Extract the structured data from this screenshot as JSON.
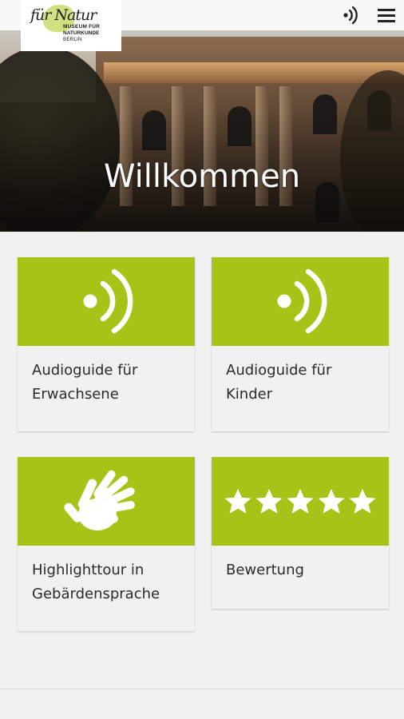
{
  "header": {
    "logo": {
      "script_text": "für Natur",
      "line1": "MUSEUM FÜR",
      "line2": "NATURKUNDE",
      "line3": "BERLIN"
    },
    "audio_icon": "audio-waves-icon",
    "menu_icon": "hamburger-menu-icon"
  },
  "hero": {
    "title": "Willkommen"
  },
  "tiles": [
    {
      "label": "Audioguide für Erwachsene",
      "icon": "audio-waves-icon"
    },
    {
      "label": "Audioguide für Kinder",
      "icon": "audio-waves-icon"
    },
    {
      "label": "Highlighttour in Gebärdensprache",
      "icon": "sign-language-hands-icon"
    },
    {
      "label": "Bewertung",
      "icon": "five-stars-icon"
    }
  ],
  "colors": {
    "accent": "#a8c318",
    "background": "#f1f1f1"
  }
}
